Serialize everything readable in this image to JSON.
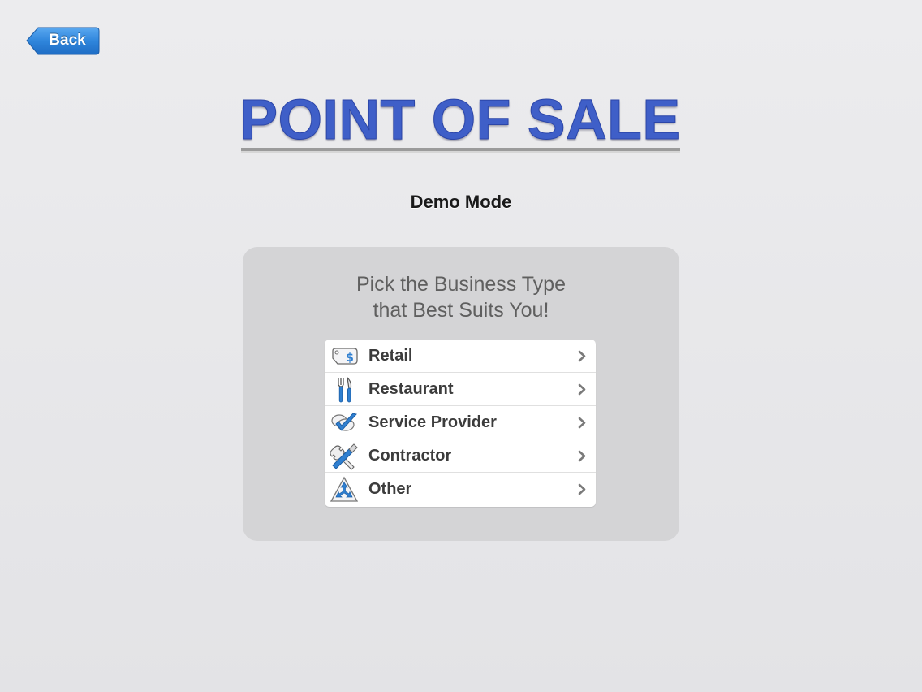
{
  "nav": {
    "back_label": "Back"
  },
  "header": {
    "title": "POINT OF SALE",
    "mode": "Demo Mode"
  },
  "panel": {
    "prompt_line1": "Pick the Business Type",
    "prompt_line2": "that Best Suits You!",
    "items": [
      {
        "label": "Retail",
        "icon": "price-tag-icon"
      },
      {
        "label": "Restaurant",
        "icon": "fork-knife-icon"
      },
      {
        "label": "Service Provider",
        "icon": "checkmark-icon"
      },
      {
        "label": "Contractor",
        "icon": "tools-icon"
      },
      {
        "label": "Other",
        "icon": "triangle-arrows-icon"
      }
    ]
  },
  "colors": {
    "title": "#3f5fc8",
    "back_button": "#3a8ee0",
    "icon_blue": "#2f7fd0"
  }
}
